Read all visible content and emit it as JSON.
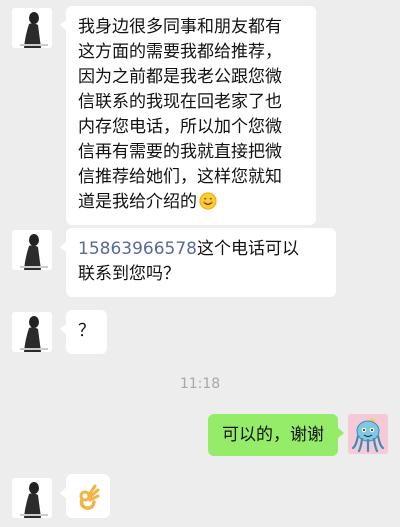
{
  "messages": [
    {
      "side": "left",
      "lines": [
        "我身边很多同事和朋友都有",
        "这方面的需要我都给推荐，",
        "因为之前都是我老公跟您微",
        "信联系的我现在回老家了也",
        "内存您电话，所以加个您微",
        "信再有需要的我就直接把微",
        "信推荐给她们，这样您就知",
        "道是我给介绍的"
      ],
      "emoji": "smile-emoji"
    },
    {
      "side": "left",
      "phone": "15863966578",
      "line1_rest": "这个电话可以",
      "line2": "联系到您吗？"
    },
    {
      "side": "left",
      "text": "？"
    },
    {
      "side": "right",
      "text": "可以的，谢谢"
    },
    {
      "side": "left",
      "emoji": "ok-hand-emoji"
    }
  ],
  "timestamp": "11:18",
  "colors": {
    "background": "#ededed",
    "self_bubble": "#95ec69",
    "link": "#576b95"
  }
}
